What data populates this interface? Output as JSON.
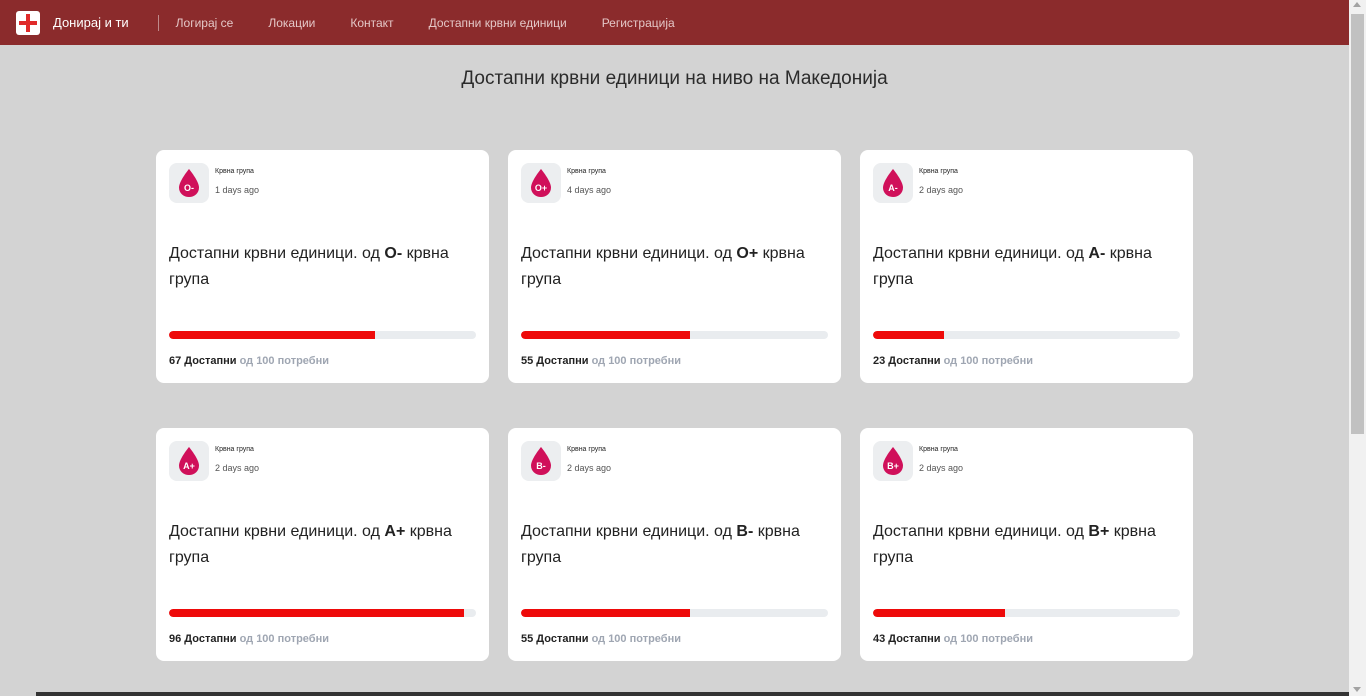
{
  "nav": {
    "brand": "Донирај и ти",
    "links": [
      "Логирај се",
      "Локации",
      "Контакт",
      "Достапни крвни единици",
      "Регистрација"
    ]
  },
  "page_title": "Достапни крвни единици на ниво на Македонија",
  "colors": {
    "navbar": "#8b2b2c",
    "progress": "#ee0a0a",
    "drop": "#d0105a",
    "muted": "#9fa6b2"
  },
  "cards": [
    {
      "icon": "blood-drop-icon",
      "group": "O-",
      "label": "Крвна група",
      "time": "1 days ago",
      "title_prefix": "Достапни крвни единици. од",
      "title_suffix": "крвна група",
      "available": 67,
      "needed": 100,
      "count_text": "67 Достапни",
      "needed_text": "од 100 потребни"
    },
    {
      "icon": "blood-drop-icon",
      "group": "O+",
      "label": "Крвна група",
      "time": "4 days ago",
      "title_prefix": "Достапни крвни единици. од",
      "title_suffix": "крвна група",
      "available": 55,
      "needed": 100,
      "count_text": "55 Достапни",
      "needed_text": "од 100 потребни"
    },
    {
      "icon": "blood-drop-icon",
      "group": "A-",
      "label": "Крвна група",
      "time": "2 days ago",
      "title_prefix": "Достапни крвни единици. од",
      "title_suffix": "крвна група",
      "available": 23,
      "needed": 100,
      "count_text": "23 Достапни",
      "needed_text": "од 100 потребни"
    },
    {
      "icon": "blood-drop-icon",
      "group": "A+",
      "label": "Крвна група",
      "time": "2 days ago",
      "title_prefix": "Достапни крвни единици. од",
      "title_suffix": "крвна група",
      "available": 96,
      "needed": 100,
      "count_text": "96 Достапни",
      "needed_text": "од 100 потребни"
    },
    {
      "icon": "blood-drop-icon",
      "group": "B-",
      "label": "Крвна група",
      "time": "2 days ago",
      "title_prefix": "Достапни крвни единици. од",
      "title_suffix": "крвна група",
      "available": 55,
      "needed": 100,
      "count_text": "55 Достапни",
      "needed_text": "од 100 потребни"
    },
    {
      "icon": "blood-drop-icon",
      "group": "B+",
      "label": "Крвна група",
      "time": "2 days ago",
      "title_prefix": "Достапни крвни единици. од",
      "title_suffix": "крвна група",
      "available": 43,
      "needed": 100,
      "count_text": "43 Достапни",
      "needed_text": "од 100 потребни"
    }
  ]
}
